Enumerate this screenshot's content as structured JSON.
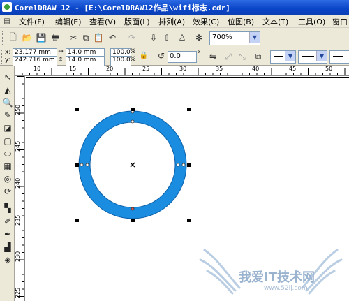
{
  "titlebar": {
    "title": "CorelDRAW 12 - [E:\\CorelDRAW12作品\\wifi标志.cdr]"
  },
  "menu": [
    "文件(F)",
    "编辑(E)",
    "查看(V)",
    "版面(L)",
    "排列(A)",
    "效果(C)",
    "位图(B)",
    "文本(T)",
    "工具(O)",
    "窗口"
  ],
  "toolbar": {
    "zoom": "700%"
  },
  "props": {
    "x_label": "x:",
    "y_label": "y:",
    "x": "23.177 mm",
    "y": "242.716 mm",
    "w": "14.0 mm",
    "h": "14.0 mm",
    "scale_w": "100.0",
    "scale_h": "100.0",
    "pct": "%",
    "angle": "0.0",
    "deg": "°"
  },
  "ruler_h": [
    "10",
    "15",
    "20",
    "25",
    "30",
    "35",
    "40",
    "45",
    "50"
  ],
  "ruler_v": [
    "250",
    "245",
    "240",
    "235",
    "230",
    "225"
  ],
  "colors": {
    "ring": "#1a8de0",
    "ring_edge": "#0b5fa8",
    "title": "#0a45c8",
    "chrome": "#ece9d8"
  },
  "watermark": {
    "text": "我爱IT技术网",
    "url": "www.52ij.com"
  }
}
